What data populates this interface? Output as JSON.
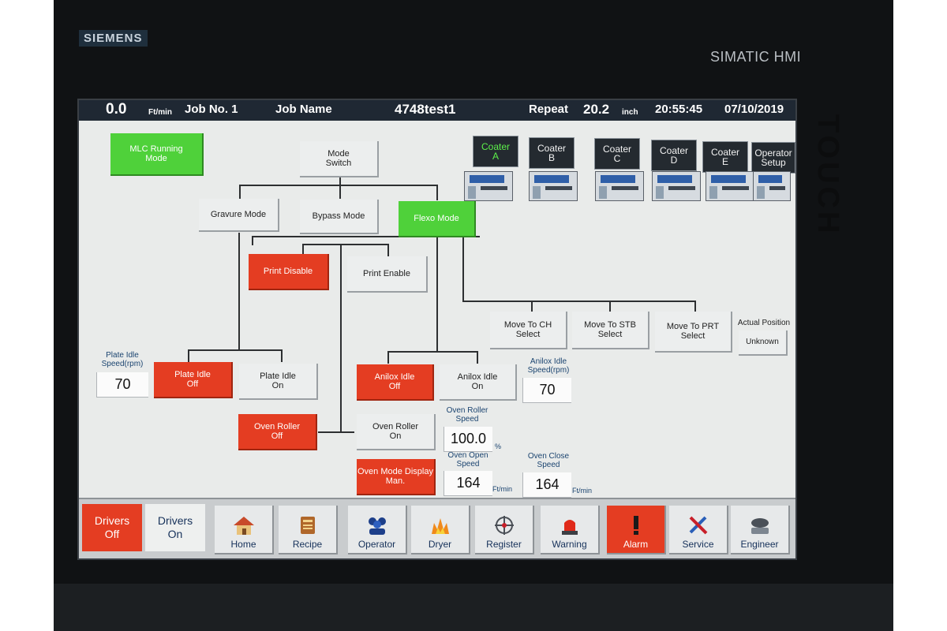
{
  "device": {
    "brand": "SIEMENS",
    "model": "SIMATIC HMI",
    "side_label": "TOUCH"
  },
  "header": {
    "speed": "0.0",
    "speed_unit": "Ft/min",
    "job_no": "Job No. 1",
    "job_name_label": "Job Name",
    "job_name": "4748test1",
    "repeat_label": "Repeat",
    "repeat_value": "20.2",
    "repeat_unit": "inch",
    "time": "20:55:45",
    "date": "07/10/2019"
  },
  "coaters": [
    {
      "line1": "Coater",
      "line2": "A",
      "active": true
    },
    {
      "line1": "Coater",
      "line2": "B",
      "active": false
    },
    {
      "line1": "Coater",
      "line2": "C",
      "active": false
    },
    {
      "line1": "Coater",
      "line2": "D",
      "active": false
    },
    {
      "line1": "Coater",
      "line2": "E",
      "active": false
    },
    {
      "line1": "Operator",
      "line2": "Setup",
      "active": false
    }
  ],
  "flow": {
    "mlc_running_mode": "MLC Running\nMode",
    "mode_switch": "Mode\nSwitch",
    "gravure_mode": "Gravure Mode",
    "bypass_mode": "Bypass Mode",
    "flexo_mode": "Flexo Mode",
    "print_disable": "Print Disable",
    "print_enable": "Print Enable",
    "move_to_ch": "Move To CH\nSelect",
    "move_to_stb": "Move To STB\nSelect",
    "move_to_prt": "Move To PRT\nSelect",
    "actual_position_label": "Actual Position",
    "actual_position_value": "Unknown",
    "plate_idle_speed_label": "Plate Idle\nSpeed(rpm)",
    "plate_idle_speed": "70",
    "plate_idle_off": "Plate Idle\nOff",
    "plate_idle_on": "Plate Idle\nOn",
    "anilox_idle_off": "Anilox Idle\nOff",
    "anilox_idle_on": "Anilox Idle\nOn",
    "anilox_idle_speed_label": "Anilox Idle\nSpeed(rpm)",
    "anilox_idle_speed": "70",
    "oven_roller_off": "Oven Roller\nOff",
    "oven_roller_on": "Oven Roller\nOn",
    "oven_roller_speed_label": "Oven Roller\nSpeed",
    "oven_roller_speed": "100.0",
    "oven_roller_speed_unit": "%",
    "oven_mode_display": "Oven Mode Display\nMan.",
    "oven_open_speed_label": "Oven Open\nSpeed",
    "oven_open_speed": "164",
    "oven_open_unit": "Ft/min",
    "oven_close_speed_label": "Oven Close\nSpeed",
    "oven_close_speed": "164",
    "oven_close_unit": "Ft/min"
  },
  "footer": {
    "drivers_off": "Drivers\nOff",
    "drivers_on": "Drivers\nOn",
    "nav": [
      {
        "label": "Home",
        "icon": "home-icon"
      },
      {
        "label": "Recipe",
        "icon": "recipe-icon"
      },
      {
        "label": "Operator",
        "icon": "operator-icon"
      },
      {
        "label": "Dryer",
        "icon": "dryer-flame-icon"
      },
      {
        "label": "Register",
        "icon": "register-crosshair-icon"
      },
      {
        "label": "Warning",
        "icon": "warning-beacon-icon"
      },
      {
        "label": "Alarm",
        "icon": "alarm-exclamation-icon"
      },
      {
        "label": "Service",
        "icon": "service-tools-icon"
      },
      {
        "label": "Engineer",
        "icon": "engineer-icon"
      }
    ]
  },
  "colors": {
    "active_green": "#4fd13a",
    "alert_red": "#e43d22",
    "header_bg": "#1f2833",
    "label_blue": "#1b4470"
  }
}
